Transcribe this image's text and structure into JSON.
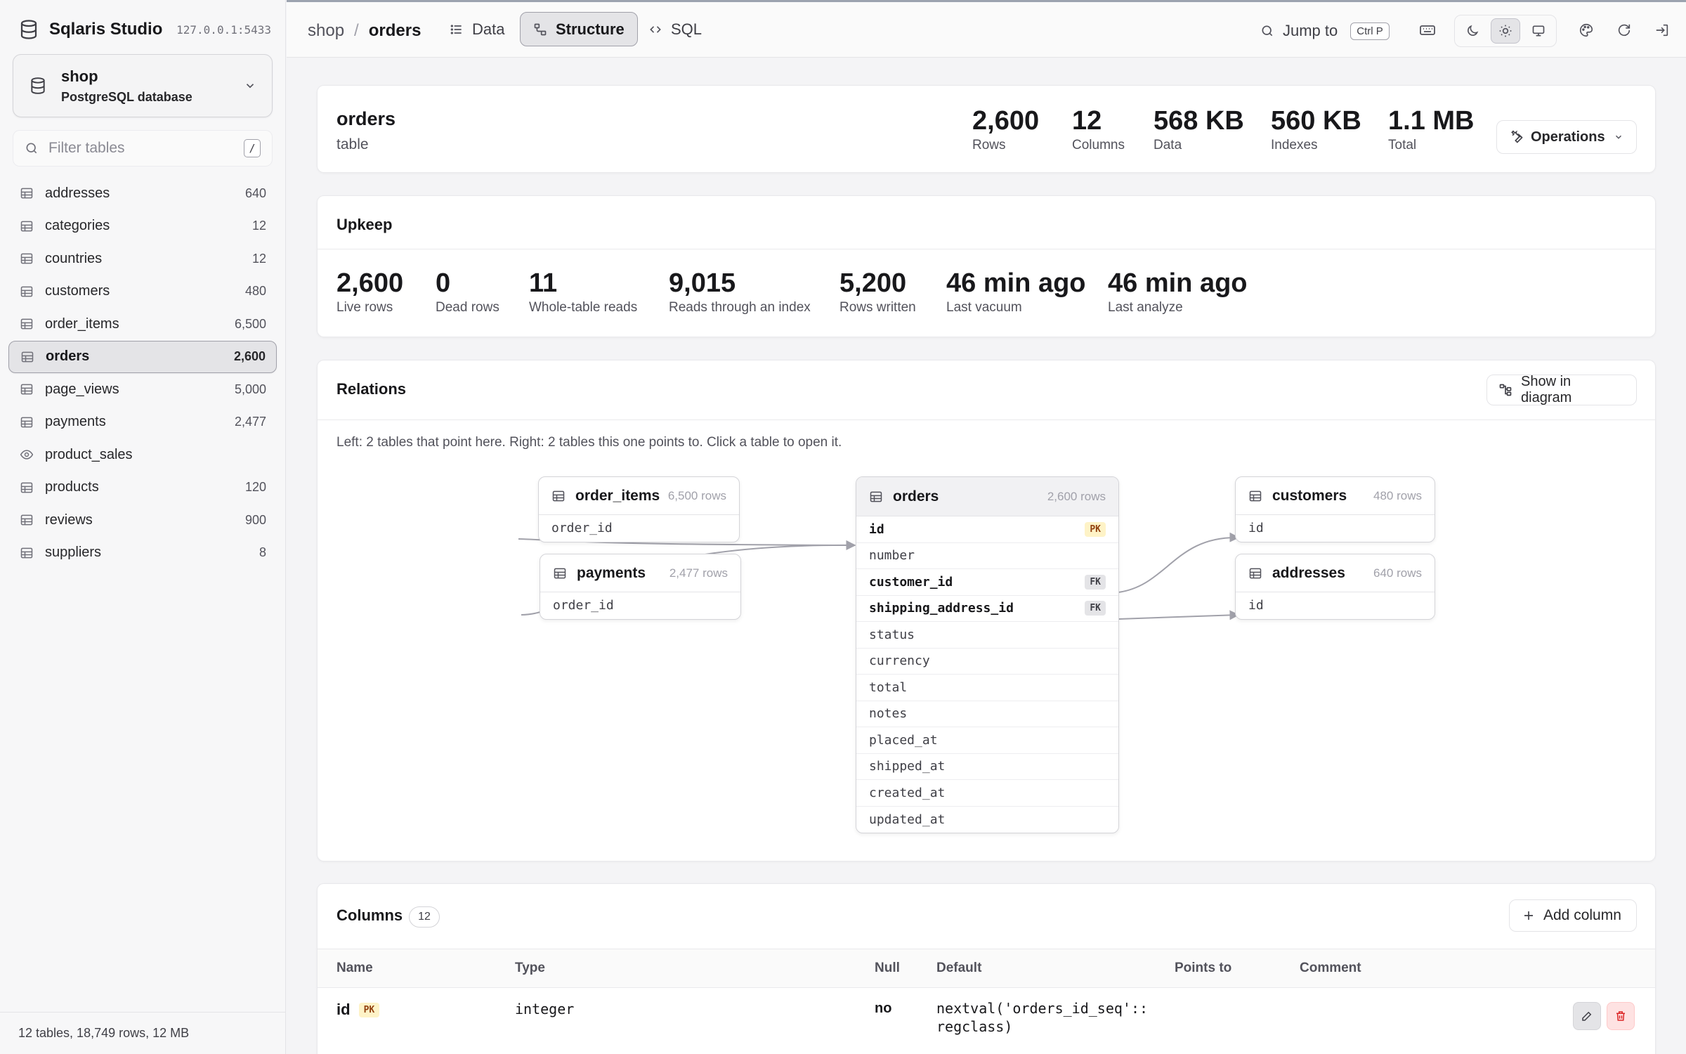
{
  "app": {
    "name": "Sqlaris Studio",
    "host": "127.0.0.1:5433"
  },
  "database": {
    "name": "shop",
    "engine": "PostgreSQL database"
  },
  "filter": {
    "placeholder": "Filter tables",
    "shortcut": "/"
  },
  "tables": [
    {
      "name": "addresses",
      "count": "640",
      "kind": "table"
    },
    {
      "name": "categories",
      "count": "12",
      "kind": "table"
    },
    {
      "name": "countries",
      "count": "12",
      "kind": "table"
    },
    {
      "name": "customers",
      "count": "480",
      "kind": "table"
    },
    {
      "name": "order_items",
      "count": "6,500",
      "kind": "table"
    },
    {
      "name": "orders",
      "count": "2,600",
      "kind": "table",
      "active": true
    },
    {
      "name": "page_views",
      "count": "5,000",
      "kind": "table"
    },
    {
      "name": "payments",
      "count": "2,477",
      "kind": "table"
    },
    {
      "name": "product_sales",
      "count": "",
      "kind": "view"
    },
    {
      "name": "products",
      "count": "120",
      "kind": "table"
    },
    {
      "name": "reviews",
      "count": "900",
      "kind": "table"
    },
    {
      "name": "suppliers",
      "count": "8",
      "kind": "table"
    }
  ],
  "sidebar_footer": "12 tables, 18,749 rows, 12 MB",
  "breadcrumb": {
    "db": "shop",
    "sep": "/",
    "table": "orders"
  },
  "view_tabs": [
    {
      "label": "Data",
      "icon": "list-icon"
    },
    {
      "label": "Structure",
      "icon": "structure-icon",
      "active": true
    },
    {
      "label": "SQL",
      "icon": "code-icon"
    }
  ],
  "jump": {
    "label": "Jump to",
    "shortcut": "Ctrl P"
  },
  "theme": {
    "selected": "light"
  },
  "header": {
    "title": "orders",
    "subtitle": "table",
    "stats": [
      {
        "value": "2,600",
        "label": "Rows"
      },
      {
        "value": "12",
        "label": "Columns"
      },
      {
        "value": "568 KB",
        "label": "Data"
      },
      {
        "value": "560 KB",
        "label": "Indexes"
      },
      {
        "value": "1.1 MB",
        "label": "Total"
      }
    ],
    "operations_label": "Operations"
  },
  "upkeep": {
    "title": "Upkeep",
    "stats": [
      {
        "value": "2,600",
        "label": "Live rows"
      },
      {
        "value": "0",
        "label": "Dead rows"
      },
      {
        "value": "11",
        "label": "Whole-table reads"
      },
      {
        "value": "9,015",
        "label": "Reads through an index"
      },
      {
        "value": "5,200",
        "label": "Rows written"
      },
      {
        "value": "46 min ago",
        "label": "Last vacuum"
      },
      {
        "value": "46 min ago",
        "label": "Last analyze"
      }
    ]
  },
  "relations": {
    "title": "Relations",
    "diagram_label": "Show in diagram",
    "hint": "Left: 2 tables that point here. Right: 2 tables this one points to. Click a table to open it.",
    "incoming": [
      {
        "name": "order_items",
        "rows": "6,500 rows",
        "field": "order_id"
      },
      {
        "name": "payments",
        "rows": "2,477 rows",
        "field": "order_id"
      }
    ],
    "center": {
      "name": "orders",
      "rows": "2,600 rows",
      "fields": [
        {
          "name": "id",
          "badge": "PK"
        },
        {
          "name": "number",
          "badge": ""
        },
        {
          "name": "customer_id",
          "badge": "FK"
        },
        {
          "name": "shipping_address_id",
          "badge": "FK"
        },
        {
          "name": "status",
          "badge": ""
        },
        {
          "name": "currency",
          "badge": ""
        },
        {
          "name": "total",
          "badge": ""
        },
        {
          "name": "notes",
          "badge": ""
        },
        {
          "name": "placed_at",
          "badge": ""
        },
        {
          "name": "shipped_at",
          "badge": ""
        },
        {
          "name": "created_at",
          "badge": ""
        },
        {
          "name": "updated_at",
          "badge": ""
        }
      ]
    },
    "outgoing": [
      {
        "name": "customers",
        "rows": "480 rows",
        "field": "id"
      },
      {
        "name": "addresses",
        "rows": "640 rows",
        "field": "id"
      }
    ]
  },
  "columns": {
    "title": "Columns",
    "count": "12",
    "add_label": "Add column",
    "headers": [
      "Name",
      "Type",
      "Null",
      "Default",
      "Points to",
      "Comment"
    ],
    "rows": [
      {
        "name": "id",
        "badge": "PK",
        "type": "integer",
        "null": "no",
        "default_line1": "nextval('orders_id_seq'::",
        "default_line2": "regclass)",
        "points_to": "",
        "comment": ""
      }
    ]
  }
}
